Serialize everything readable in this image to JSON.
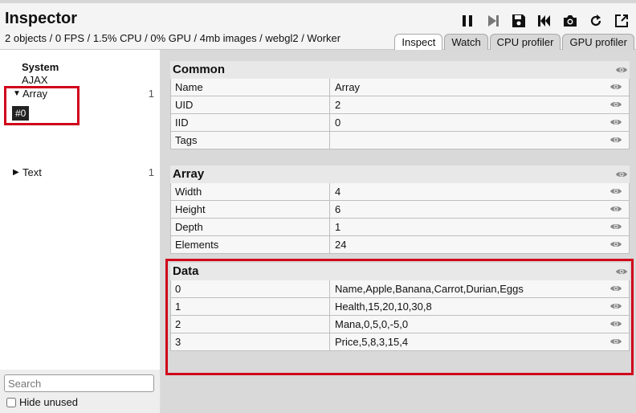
{
  "header": {
    "title": "Inspector",
    "status": "2 objects / 0 FPS / 1.5% CPU / 0% GPU / 4mb images / webgl2 / Worker"
  },
  "toolbar": [
    "pause-icon",
    "step-icon",
    "save-icon",
    "rewind-icon",
    "camera-icon",
    "refresh-icon",
    "popout-icon"
  ],
  "tabs": [
    {
      "label": "Inspect",
      "active": true
    },
    {
      "label": "Watch"
    },
    {
      "label": "CPU profiler"
    },
    {
      "label": "GPU profiler"
    }
  ],
  "sidebar": {
    "system_title": "System",
    "system_sub": "AJAX",
    "items": [
      {
        "label": "Array",
        "count": "1",
        "expanded": true
      },
      {
        "label": "Text",
        "count": "1",
        "expanded": false
      }
    ],
    "instance": "#0",
    "search_placeholder": "Search",
    "hide_unused": "Hide unused"
  },
  "panels": [
    {
      "title": "Common",
      "rows": [
        [
          "Name",
          "Array"
        ],
        [
          "UID",
          "2"
        ],
        [
          "IID",
          "0"
        ],
        [
          "Tags",
          ""
        ]
      ]
    },
    {
      "title": "Array",
      "rows": [
        [
          "Width",
          "4"
        ],
        [
          "Height",
          "6"
        ],
        [
          "Depth",
          "1"
        ],
        [
          "Elements",
          "24"
        ]
      ]
    },
    {
      "title": "Data",
      "rows": [
        [
          "0",
          "Name,Apple,Banana,Carrot,Durian,Eggs"
        ],
        [
          "1",
          "Health,15,20,10,30,8"
        ],
        [
          "2",
          "Mana,0,5,0,-5,0"
        ],
        [
          "3",
          "Price,5,8,3,15,4"
        ]
      ]
    }
  ],
  "colors": {
    "highlight": "#d0021b"
  }
}
